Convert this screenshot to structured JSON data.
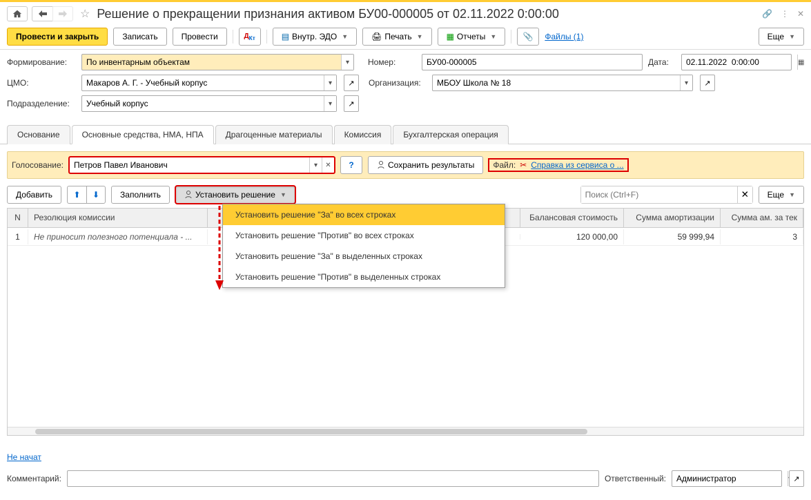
{
  "title": "Решение о прекращении признания активом БУ00-000005 от 02.11.2022 0:00:00",
  "toolbar": {
    "post_close": "Провести и закрыть",
    "write": "Записать",
    "post": "Провести",
    "edo": "Внутр. ЭДО",
    "print": "Печать",
    "reports": "Отчеты",
    "files": "Файлы (1)",
    "more": "Еще"
  },
  "form": {
    "forming_lbl": "Формирование:",
    "forming_val": "По инвентарным объектам",
    "cmo_lbl": "ЦМО:",
    "cmo_val": "Макаров А. Г. - Учебный корпус",
    "dep_lbl": "Подразделение:",
    "dep_val": "Учебный корпус",
    "number_lbl": "Номер:",
    "number_val": "БУ00-000005",
    "date_lbl": "Дата:",
    "date_val": "02.11.2022  0:00:00",
    "org_lbl": "Организация:",
    "org_val": "МБОУ Школа № 18"
  },
  "tabs": {
    "t1": "Основание",
    "t2": "Основные средства, НМА, НПА",
    "t3": "Драгоценные материалы",
    "t4": "Комиссия",
    "t5": "Бухгалтерская операция"
  },
  "vote": {
    "lbl": "Голосование:",
    "val": "Петров Павел Иванович",
    "save": "Сохранить результаты",
    "file_lbl": "Файл:",
    "file_link": "Справка из сервиса о ..."
  },
  "tblbar": {
    "add": "Добавить",
    "fill": "Заполнить",
    "set": "Установить решение",
    "search_ph": "Поиск (Ctrl+F)",
    "more": "Еще"
  },
  "dropdown": {
    "i1": "Установить решение \"За\" во всех строках",
    "i2": "Установить решение \"Против\" во всех строках",
    "i3": "Установить решение \"За\" в выделенных строках",
    "i4": "Установить решение \"Против\" в выделенных строках"
  },
  "gridh": {
    "n": "N",
    "res": "Резолюция комиссии",
    "bal": "Балансовая стоимость",
    "am1": "Сумма амортизации",
    "am2": "Сумма ам. за тек"
  },
  "gridr": {
    "n": "1",
    "res": "Не приносит полезного потенциала - ...",
    "bal": "120 000,00",
    "am1": "59 999,94",
    "am2": "3"
  },
  "footer": {
    "status": "Не начат",
    "comment_lbl": "Комментарий:",
    "resp_lbl": "Ответственный:",
    "resp_val": "Администратор"
  }
}
